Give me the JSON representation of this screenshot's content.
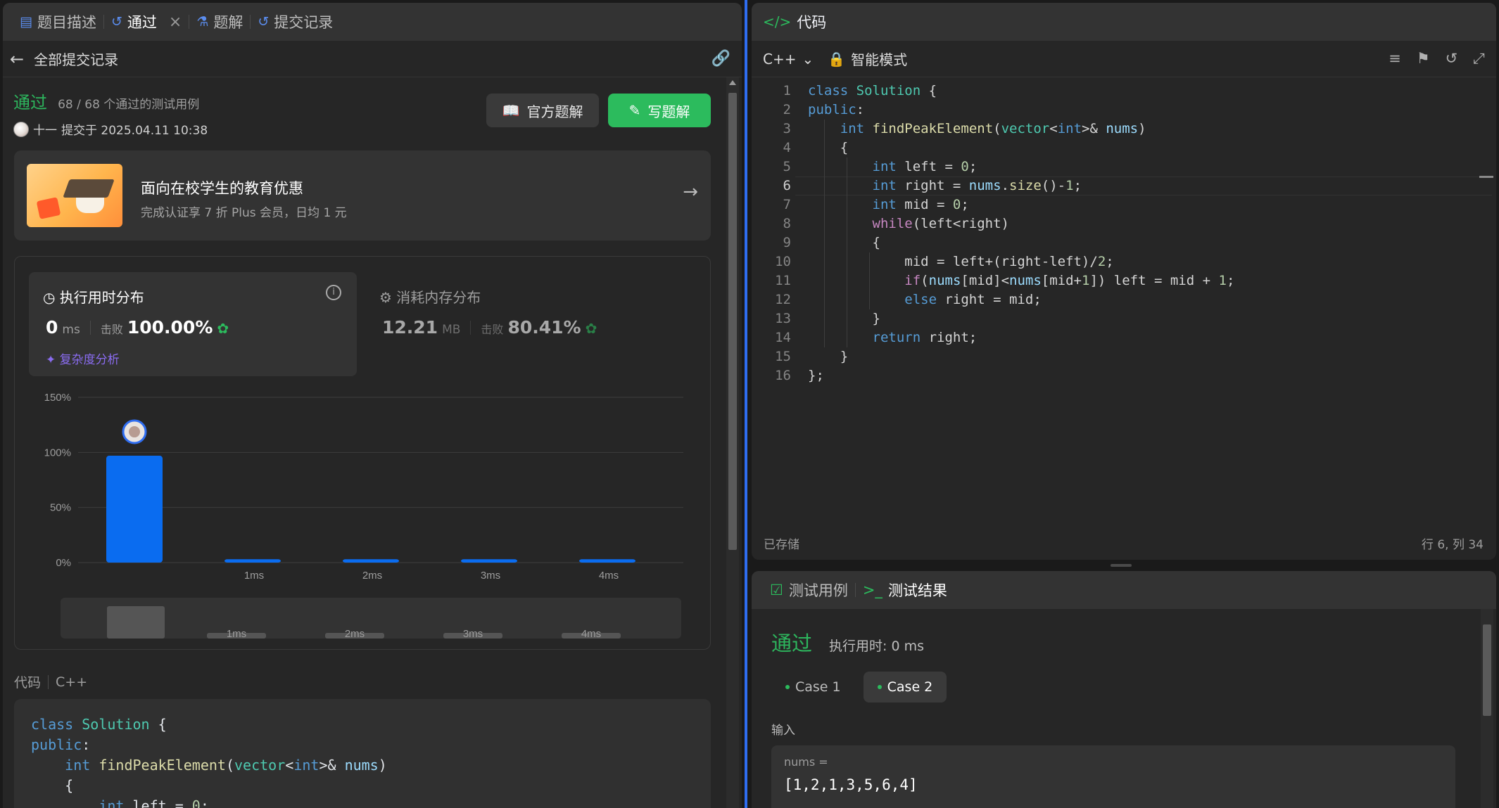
{
  "left_tabs": [
    {
      "label": "题目描述",
      "icon": "document-icon"
    },
    {
      "label": "通过",
      "icon": "history-icon"
    },
    {
      "label": "题解",
      "icon": "flask-icon"
    },
    {
      "label": "提交记录",
      "icon": "history-icon"
    }
  ],
  "back_row": {
    "label": "全部提交记录"
  },
  "submission": {
    "status": "通过",
    "stats": "68 / 68 个通过的测试用例",
    "submitter": "十一",
    "submitted_at": "提交于 2025.04.11 10:38"
  },
  "buttons": {
    "official": "官方题解",
    "write": "写题解"
  },
  "promo": {
    "title": "面向在校学生的教育优惠",
    "subtitle": "完成认证享 7 折 Plus 会员，日均 1 元"
  },
  "runtime": {
    "header": "执行用时分布",
    "value": "0",
    "unit": "ms",
    "beats_label": "击败",
    "beats": "100.00%",
    "complexity": "复杂度分析"
  },
  "memory": {
    "header": "消耗内存分布",
    "value": "12.21",
    "unit": "MB",
    "beats_label": "击败",
    "beats": "80.41%"
  },
  "chart_data": {
    "type": "bar",
    "categories": [
      "0ms",
      "1ms",
      "2ms",
      "3ms",
      "4ms"
    ],
    "x_tick_labels": [
      "",
      "1ms",
      "2ms",
      "3ms",
      "4ms"
    ],
    "values": [
      97,
      3,
      3,
      3,
      3
    ],
    "yticks": [
      "150%",
      "100%",
      "50%",
      "0%"
    ],
    "ylim": [
      0,
      150
    ],
    "bar_color": "#0a6cf0",
    "highlighted_category": "0ms",
    "brush_labels": [
      "1ms",
      "2ms",
      "3ms",
      "4ms"
    ]
  },
  "code_section": {
    "label": "代码",
    "lang": "C++"
  },
  "code_preview": [
    "class Solution {",
    "public:",
    "    int findPeakElement(vector<int>& nums)",
    "    {",
    "        int left = 0;"
  ],
  "editor": {
    "tab": "代码",
    "language": "C++",
    "mode": "智能模式",
    "saved": "已存储",
    "cursor": "行 6, 列 34",
    "lines": [
      "class Solution {",
      "public:",
      "    int findPeakElement(vector<int>& nums)",
      "    {",
      "        int left = 0;",
      "        int right = nums.size()-1;",
      "        int mid = 0;",
      "        while(left<right)",
      "        {",
      "            mid = left+(right-left)/2;",
      "            if(nums[mid]<nums[mid+1]) left = mid + 1;",
      "            else right = mid;",
      "        }",
      "        return right;",
      "    }",
      "};"
    ]
  },
  "result": {
    "tabs": [
      "测试用例",
      "测试结果"
    ],
    "status": "通过",
    "runtime": "执行用时: 0 ms",
    "cases": [
      "Case 1",
      "Case 2"
    ],
    "input_label": "输入",
    "input_var": "nums =",
    "input_value": "[1,2,1,3,5,6,4]"
  },
  "colors": {
    "accent_green": "#2cbb5d",
    "accent_blue": "#2f6df0",
    "bar_blue": "#0a6cf0"
  }
}
